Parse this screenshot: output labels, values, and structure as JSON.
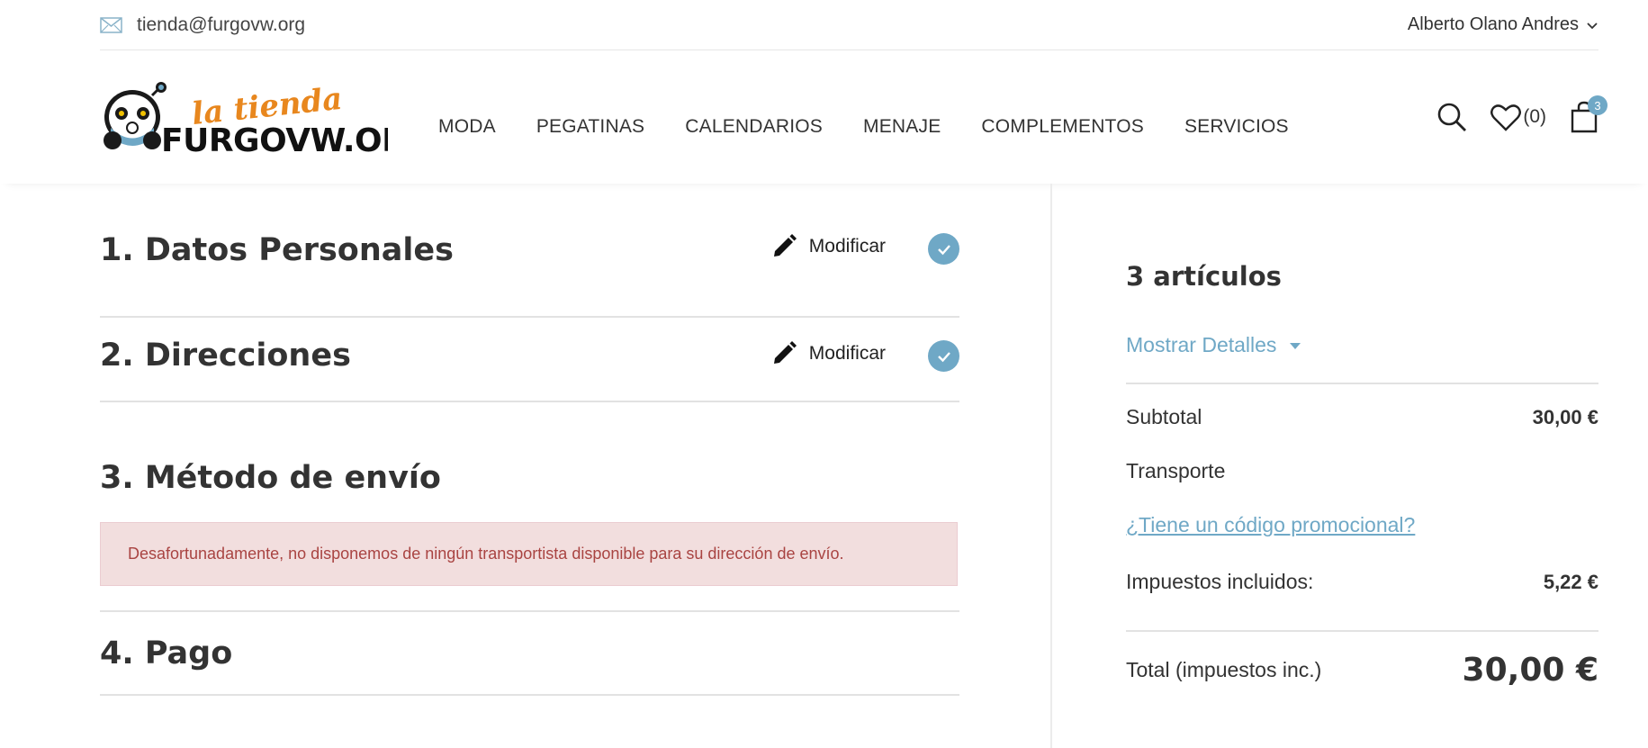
{
  "topbar": {
    "email": "tienda@furgovw.org",
    "user_name": "Alberto Olano Andres"
  },
  "logo": {
    "line1": "la tienda",
    "line2": "FURGOVW.ORG"
  },
  "nav": {
    "items": [
      "MODA",
      "PEGATINAS",
      "CALENDARIOS",
      "MENAJE",
      "COMPLEMENTOS",
      "SERVICIOS"
    ]
  },
  "header_icons": {
    "wishlist_count": "(0)",
    "cart_count": "3"
  },
  "checkout": {
    "steps": [
      {
        "title": "1. Datos Personales",
        "edit_label": "Modificar",
        "completed": true
      },
      {
        "title": "2. Direcciones",
        "edit_label": "Modificar",
        "completed": true
      },
      {
        "title": "3. Método de envío"
      },
      {
        "title": "4. Pago"
      }
    ],
    "shipping_error": "Desafortunadamente, no disponemos de ningún transportista disponible para su dirección de envío."
  },
  "summary": {
    "items_count": "3 artículos",
    "show_details": "Mostrar Detalles",
    "subtotal_label": "Subtotal",
    "subtotal_value": "30,00 €",
    "shipping_label": "Transporte",
    "promo_link": "¿Tiene un código promocional?",
    "taxes_label": "Impuestos incluidos:",
    "taxes_value": "5,22 €",
    "total_label": "Total (impuestos inc.)",
    "total_value": "30,00 €"
  },
  "colors": {
    "accent": "#6fa8c6",
    "error_bg": "#f2dede",
    "error_text": "#a94442",
    "logo_orange": "#e8871e"
  }
}
